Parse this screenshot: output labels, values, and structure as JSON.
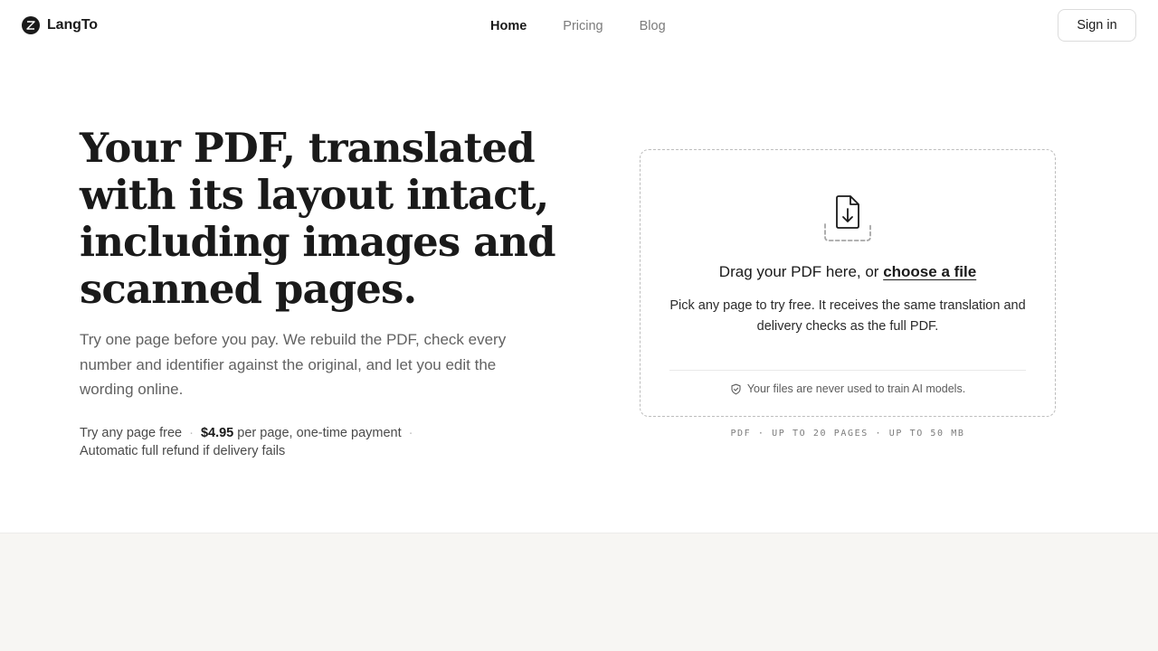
{
  "brand": {
    "name": "LangTo"
  },
  "nav": {
    "items": [
      {
        "label": "Home",
        "active": true
      },
      {
        "label": "Pricing",
        "active": false
      },
      {
        "label": "Blog",
        "active": false
      }
    ],
    "signin_label": "Sign in"
  },
  "hero": {
    "title": "Your PDF, translated with its layout intact, including images and scanned pages.",
    "subtitle": "Try one page before you pay. We rebuild the PDF, check every number and identifier against the original, and let you edit the wording online.",
    "pricing": {
      "free": "Try any page free",
      "price": "$4.95",
      "price_suffix": " per page, one-time payment",
      "refund": "Automatic full refund if delivery fails"
    }
  },
  "upload": {
    "prompt_prefix": "Drag your PDF here, or ",
    "choose_link": "choose a file",
    "note": "Pick any page to try free. It receives the same translation and delivery checks as the full PDF.",
    "privacy": "Your files are never used to train AI models.",
    "limits": "PDF · UP TO 20 PAGES · UP TO 50 MB"
  },
  "icons": {
    "logo": "langto-logo-icon",
    "upload": "file-download-icon",
    "privacy": "shield-check-icon"
  },
  "colors": {
    "text": "#1a1a1a",
    "muted": "#7b7b7b",
    "band": "#f7f6f3"
  }
}
